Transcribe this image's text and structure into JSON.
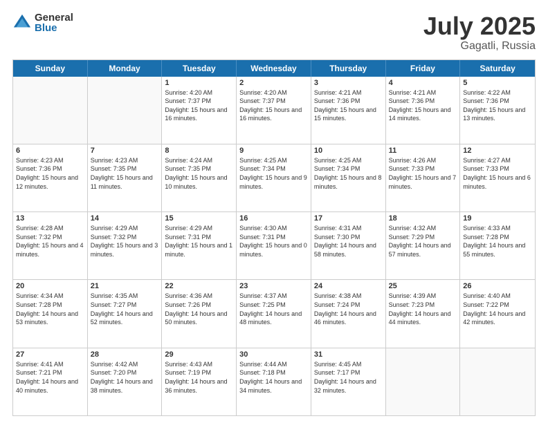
{
  "logo": {
    "general": "General",
    "blue": "Blue"
  },
  "title": {
    "month": "July 2025",
    "location": "Gagatli, Russia"
  },
  "header_days": [
    "Sunday",
    "Monday",
    "Tuesday",
    "Wednesday",
    "Thursday",
    "Friday",
    "Saturday"
  ],
  "weeks": [
    [
      {
        "day": "",
        "info": ""
      },
      {
        "day": "",
        "info": ""
      },
      {
        "day": "1",
        "info": "Sunrise: 4:20 AM\nSunset: 7:37 PM\nDaylight: 15 hours and 16 minutes."
      },
      {
        "day": "2",
        "info": "Sunrise: 4:20 AM\nSunset: 7:37 PM\nDaylight: 15 hours and 16 minutes."
      },
      {
        "day": "3",
        "info": "Sunrise: 4:21 AM\nSunset: 7:36 PM\nDaylight: 15 hours and 15 minutes."
      },
      {
        "day": "4",
        "info": "Sunrise: 4:21 AM\nSunset: 7:36 PM\nDaylight: 15 hours and 14 minutes."
      },
      {
        "day": "5",
        "info": "Sunrise: 4:22 AM\nSunset: 7:36 PM\nDaylight: 15 hours and 13 minutes."
      }
    ],
    [
      {
        "day": "6",
        "info": "Sunrise: 4:23 AM\nSunset: 7:36 PM\nDaylight: 15 hours and 12 minutes."
      },
      {
        "day": "7",
        "info": "Sunrise: 4:23 AM\nSunset: 7:35 PM\nDaylight: 15 hours and 11 minutes."
      },
      {
        "day": "8",
        "info": "Sunrise: 4:24 AM\nSunset: 7:35 PM\nDaylight: 15 hours and 10 minutes."
      },
      {
        "day": "9",
        "info": "Sunrise: 4:25 AM\nSunset: 7:34 PM\nDaylight: 15 hours and 9 minutes."
      },
      {
        "day": "10",
        "info": "Sunrise: 4:25 AM\nSunset: 7:34 PM\nDaylight: 15 hours and 8 minutes."
      },
      {
        "day": "11",
        "info": "Sunrise: 4:26 AM\nSunset: 7:33 PM\nDaylight: 15 hours and 7 minutes."
      },
      {
        "day": "12",
        "info": "Sunrise: 4:27 AM\nSunset: 7:33 PM\nDaylight: 15 hours and 6 minutes."
      }
    ],
    [
      {
        "day": "13",
        "info": "Sunrise: 4:28 AM\nSunset: 7:32 PM\nDaylight: 15 hours and 4 minutes."
      },
      {
        "day": "14",
        "info": "Sunrise: 4:29 AM\nSunset: 7:32 PM\nDaylight: 15 hours and 3 minutes."
      },
      {
        "day": "15",
        "info": "Sunrise: 4:29 AM\nSunset: 7:31 PM\nDaylight: 15 hours and 1 minute."
      },
      {
        "day": "16",
        "info": "Sunrise: 4:30 AM\nSunset: 7:31 PM\nDaylight: 15 hours and 0 minutes."
      },
      {
        "day": "17",
        "info": "Sunrise: 4:31 AM\nSunset: 7:30 PM\nDaylight: 14 hours and 58 minutes."
      },
      {
        "day": "18",
        "info": "Sunrise: 4:32 AM\nSunset: 7:29 PM\nDaylight: 14 hours and 57 minutes."
      },
      {
        "day": "19",
        "info": "Sunrise: 4:33 AM\nSunset: 7:28 PM\nDaylight: 14 hours and 55 minutes."
      }
    ],
    [
      {
        "day": "20",
        "info": "Sunrise: 4:34 AM\nSunset: 7:28 PM\nDaylight: 14 hours and 53 minutes."
      },
      {
        "day": "21",
        "info": "Sunrise: 4:35 AM\nSunset: 7:27 PM\nDaylight: 14 hours and 52 minutes."
      },
      {
        "day": "22",
        "info": "Sunrise: 4:36 AM\nSunset: 7:26 PM\nDaylight: 14 hours and 50 minutes."
      },
      {
        "day": "23",
        "info": "Sunrise: 4:37 AM\nSunset: 7:25 PM\nDaylight: 14 hours and 48 minutes."
      },
      {
        "day": "24",
        "info": "Sunrise: 4:38 AM\nSunset: 7:24 PM\nDaylight: 14 hours and 46 minutes."
      },
      {
        "day": "25",
        "info": "Sunrise: 4:39 AM\nSunset: 7:23 PM\nDaylight: 14 hours and 44 minutes."
      },
      {
        "day": "26",
        "info": "Sunrise: 4:40 AM\nSunset: 7:22 PM\nDaylight: 14 hours and 42 minutes."
      }
    ],
    [
      {
        "day": "27",
        "info": "Sunrise: 4:41 AM\nSunset: 7:21 PM\nDaylight: 14 hours and 40 minutes."
      },
      {
        "day": "28",
        "info": "Sunrise: 4:42 AM\nSunset: 7:20 PM\nDaylight: 14 hours and 38 minutes."
      },
      {
        "day": "29",
        "info": "Sunrise: 4:43 AM\nSunset: 7:19 PM\nDaylight: 14 hours and 36 minutes."
      },
      {
        "day": "30",
        "info": "Sunrise: 4:44 AM\nSunset: 7:18 PM\nDaylight: 14 hours and 34 minutes."
      },
      {
        "day": "31",
        "info": "Sunrise: 4:45 AM\nSunset: 7:17 PM\nDaylight: 14 hours and 32 minutes."
      },
      {
        "day": "",
        "info": ""
      },
      {
        "day": "",
        "info": ""
      }
    ]
  ]
}
